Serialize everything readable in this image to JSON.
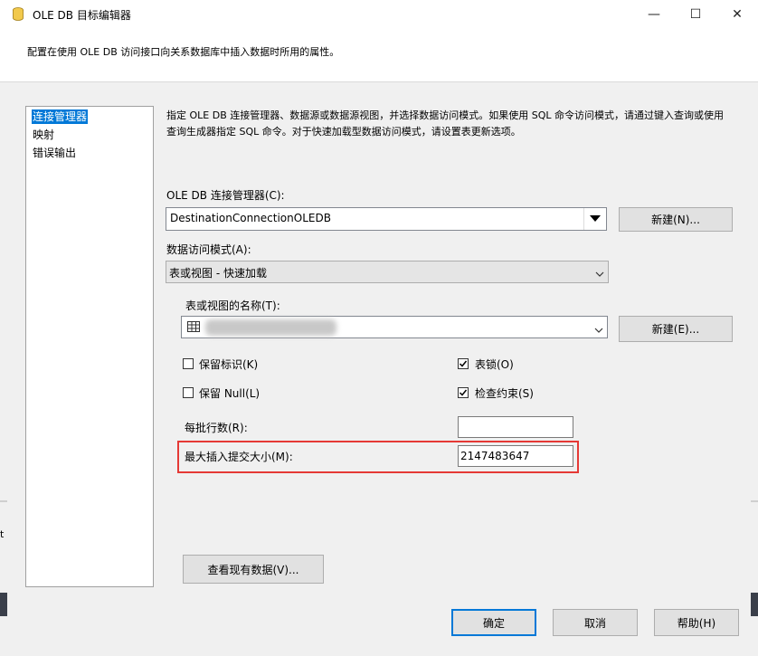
{
  "window": {
    "title": "OLE DB 目标编辑器",
    "description": "配置在使用 OLE DB 访问接口向关系数据库中插入数据时所用的属性。"
  },
  "titlebar_buttons": {
    "minimize": "—",
    "maximize": "☐",
    "close": "✕"
  },
  "nav": {
    "items": [
      {
        "label": "连接管理器",
        "selected": true
      },
      {
        "label": "映射",
        "selected": false
      },
      {
        "label": "错误输出",
        "selected": false
      }
    ]
  },
  "main": {
    "info_text": "指定 OLE DB 连接管理器、数据源或数据源视图，并选择数据访问模式。如果使用 SQL 命令访问模式，请通过键入查询或使用查询生成器指定 SQL 命令。对于快速加载型数据访问模式，请设置表更新选项。",
    "conn_label": "OLE DB 连接管理器(C):",
    "conn_value": "DestinationConnectionOLEDB",
    "new_conn_button": "新建(N)...",
    "access_mode_label": "数据访问模式(A):",
    "access_mode_value": "表或视图 - 快速加载",
    "table_label": "表或视图的名称(T):",
    "new_table_button": "新建(E)...",
    "options": {
      "keep_identity": {
        "label": "保留标识(K)",
        "checked": false
      },
      "table_lock": {
        "label": "表锁(O)",
        "checked": true
      },
      "keep_nulls": {
        "label": "保留 Null(L)",
        "checked": false
      },
      "check_constraints": {
        "label": "检查约束(S)",
        "checked": true
      }
    },
    "rows_per_batch_label": "每批行数(R):",
    "rows_per_batch_value": "",
    "max_commit_label": "最大插入提交大小(M):",
    "max_commit_value": "2147483647",
    "preview_button": "查看现有数据(V)..."
  },
  "footer": {
    "ok": "确定",
    "cancel": "取消",
    "help": "帮助(H)"
  },
  "left_edge_fragment": "t",
  "colors": {
    "selection": "#0078d7",
    "highlight_box": "#e53935"
  }
}
